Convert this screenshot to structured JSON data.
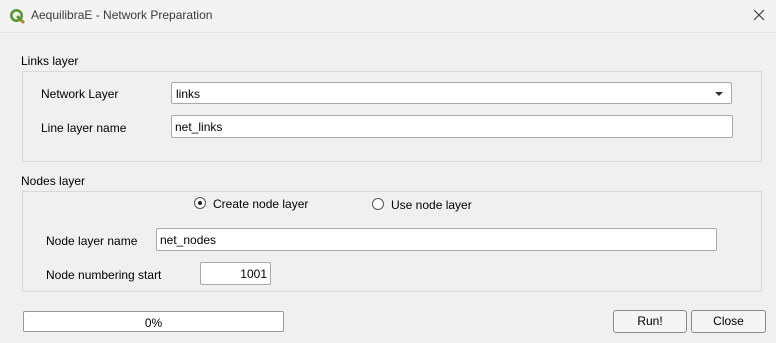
{
  "window": {
    "title": "AequilibraE - Network Preparation",
    "app_icon": "qgis-icon",
    "close_icon": "close-icon"
  },
  "links": {
    "section_title": "Links layer",
    "network_layer_label": "Network Layer",
    "network_layer_value": "links",
    "line_layer_name_label": "Line layer name",
    "line_layer_name_value": "net_links"
  },
  "nodes": {
    "section_title": "Nodes layer",
    "create_node_layer_label": "Create node layer",
    "create_node_layer_selected": true,
    "use_node_layer_label": "Use node layer",
    "use_node_layer_selected": false,
    "node_layer_name_label": "Node layer name",
    "node_layer_name_value": "net_nodes",
    "node_numbering_start_label": "Node numbering start",
    "node_numbering_start_value": "1001"
  },
  "footer": {
    "progress_value": 0,
    "progress_text": "0%",
    "run_label": "Run!",
    "close_label": "Close"
  },
  "colors": {
    "window_bg": "#f0f0f0",
    "qgis_green": "#589632",
    "qgis_yellow": "#ee7913"
  }
}
